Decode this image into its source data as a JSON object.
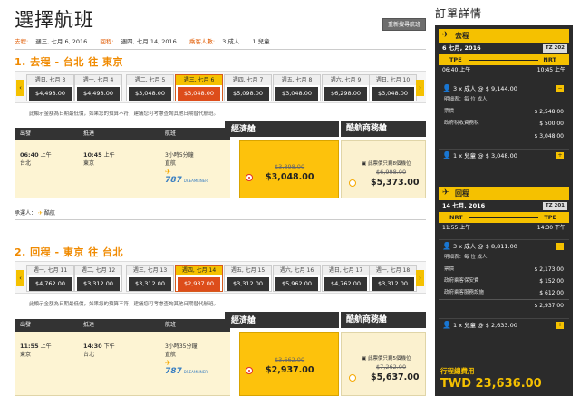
{
  "page_title": "選擇航班",
  "summary": {
    "depart_label": "去程:",
    "depart_value": "週三, 七月 6, 2016",
    "return_label": "回程:",
    "return_value": "週四, 七月 14, 2016",
    "pax_label": "乘客人數:",
    "adults": "3 成人",
    "children": "1 兒童"
  },
  "search_again": "重新搜尋航班",
  "outbound": {
    "heading": "1. 去程 - 台北 往 東京",
    "dates": [
      {
        "day": "週日, 七月 3",
        "price": "$4,498.00"
      },
      {
        "day": "週一, 七月 4",
        "price": "$4,498.00"
      },
      {
        "day": "週二, 七月 5",
        "price": "$3,048.00"
      },
      {
        "day": "週三, 七月 6",
        "price": "$3,048.00"
      },
      {
        "day": "週四, 七月 7",
        "price": "$5,098.00"
      },
      {
        "day": "週五, 七月 8",
        "price": "$3,048.00"
      },
      {
        "day": "週六, 七月 9",
        "price": "$6,298.00"
      },
      {
        "day": "週日, 七月 10",
        "price": "$3,048.00"
      }
    ],
    "note": "此顯示金額為日期最低價，如果您的預算不符，建議您可考慮查詢其他日期替代航班。",
    "headers": {
      "depart": "出發",
      "arrive": "抵達",
      "flight": "航班",
      "eco": "經濟艙",
      "biz": "酷航商務艙"
    },
    "depart_time": "06:40",
    "depart_ampm": "上午",
    "depart_city": "台北",
    "arrive_time": "10:45",
    "arrive_ampm": "上午",
    "arrive_city": "東京",
    "duration": "3小時5分鐘",
    "stops": "直航",
    "aircraft": "787",
    "aircraft_brand": "DREAMLINER",
    "eco_old": "$3,898.00",
    "eco_price": "$3,048.00",
    "biz_seats": "此票價只剩8個機位",
    "biz_old": "$6,998.00",
    "biz_price": "$5,373.00",
    "carrier_label": "承運人：",
    "carrier": "酷航"
  },
  "inbound": {
    "heading": "2. 回程 - 東京 往 台北",
    "dates": [
      {
        "day": "週一, 七月 11",
        "price": "$4,762.00"
      },
      {
        "day": "週二, 七月 12",
        "price": "$3,312.00"
      },
      {
        "day": "週三, 七月 13",
        "price": "$3,312.00"
      },
      {
        "day": "週四, 七月 14",
        "price": "$2,937.00"
      },
      {
        "day": "週五, 七月 15",
        "price": "$3,312.00"
      },
      {
        "day": "週六, 七月 16",
        "price": "$5,962.00"
      },
      {
        "day": "週日, 七月 17",
        "price": "$4,762.00"
      },
      {
        "day": "週一, 七月 18",
        "price": "$3,312.00"
      }
    ],
    "note": "此顯示金額為日期最低價，如果您的預算不符，建議您可考慮查詢其他日期替代航班。",
    "headers": {
      "depart": "出發",
      "arrive": "抵達",
      "flight": "航班",
      "eco": "經濟艙",
      "biz": "酷航商務艙"
    },
    "depart_time": "11:55",
    "depart_ampm": "上午",
    "depart_city": "東京",
    "arrive_time": "14:30",
    "arrive_ampm": "下午",
    "arrive_city": "台北",
    "duration": "3小時35分鐘",
    "stops": "直航",
    "aircraft": "787",
    "aircraft_brand": "DREAMLINER",
    "eco_old": "$3,662.00",
    "eco_price": "$2,937.00",
    "biz_seats": "此票價只剩5個機位",
    "biz_old": "$7,262.00",
    "biz_price": "$5,637.00"
  },
  "order": {
    "title": "訂單詳情",
    "out": {
      "label": "去程",
      "date": "6 七月, 2016",
      "flight_no": "TZ 202",
      "from": "TPE",
      "to": "NRT",
      "dep": "06:40 上午",
      "arr": "10:45 上午",
      "adult_line": "3 x 成人 @ $ 9,144.00",
      "detail_label": "明細表：每 位 成人",
      "fees": [
        {
          "name": "票價",
          "value": "$ 2,548.00"
        },
        {
          "name": "政府稅收費務稅",
          "value": "$ 500.00"
        }
      ],
      "subtotal": "$ 3,048.00",
      "child_line": "1 x 兒童 @ $ 3,048.00"
    },
    "ret": {
      "label": "回程",
      "date": "14 七月, 2016",
      "flight_no": "TZ 201",
      "from": "NRT",
      "to": "TPE",
      "dep": "11:55 上午",
      "arr": "14:30 下午",
      "adult_line": "3 x 成人 @ $ 8,811.00",
      "detail_label": "明細表：每 位 成人",
      "fees": [
        {
          "name": "票價",
          "value": "$ 2,173.00"
        },
        {
          "name": "政府乘客保安費",
          "value": "$ 152.00"
        },
        {
          "name": "政府乘客服務設施",
          "value": "$ 612.00"
        }
      ],
      "subtotal": "$ 2,937.00",
      "child_line": "1 x 兒童 @ $ 2,633.00"
    },
    "total_label": "行程總費用",
    "total_value": "TWD 23,636.00"
  }
}
